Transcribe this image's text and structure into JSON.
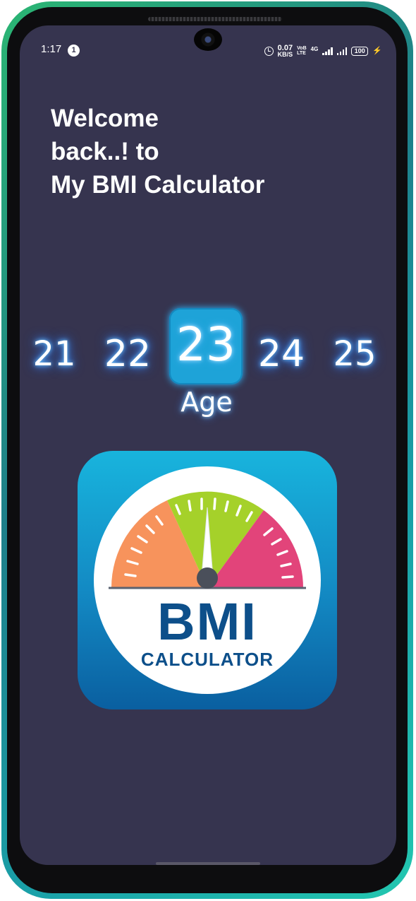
{
  "status_bar": {
    "time": "1:17",
    "notification_count": "1",
    "data_speed_value": "0.07",
    "data_speed_unit": "KB/S",
    "volte_top": "VoB",
    "volte_bottom": "LTE",
    "network": "4G",
    "battery_level": "100"
  },
  "welcome": {
    "line1": "Welcome",
    "line2": "back..! to",
    "line3": "My BMI Calculator"
  },
  "age_picker": {
    "values": [
      "21",
      "22",
      "23",
      "24",
      "25"
    ],
    "selected": "23",
    "label": "Age"
  },
  "logo": {
    "title": "BMI",
    "subtitle": "CALCULATOR",
    "colors": {
      "orange_zone": "#f7935c",
      "green_zone": "#a5d12a",
      "pink_zone": "#e2447a",
      "background_top": "#18b4dd",
      "background_bottom": "#0a5fa0",
      "text": "#0d4f8a"
    }
  },
  "theme": {
    "screen_background": "#36344f",
    "selected_age_background": "#1ea3d8"
  }
}
